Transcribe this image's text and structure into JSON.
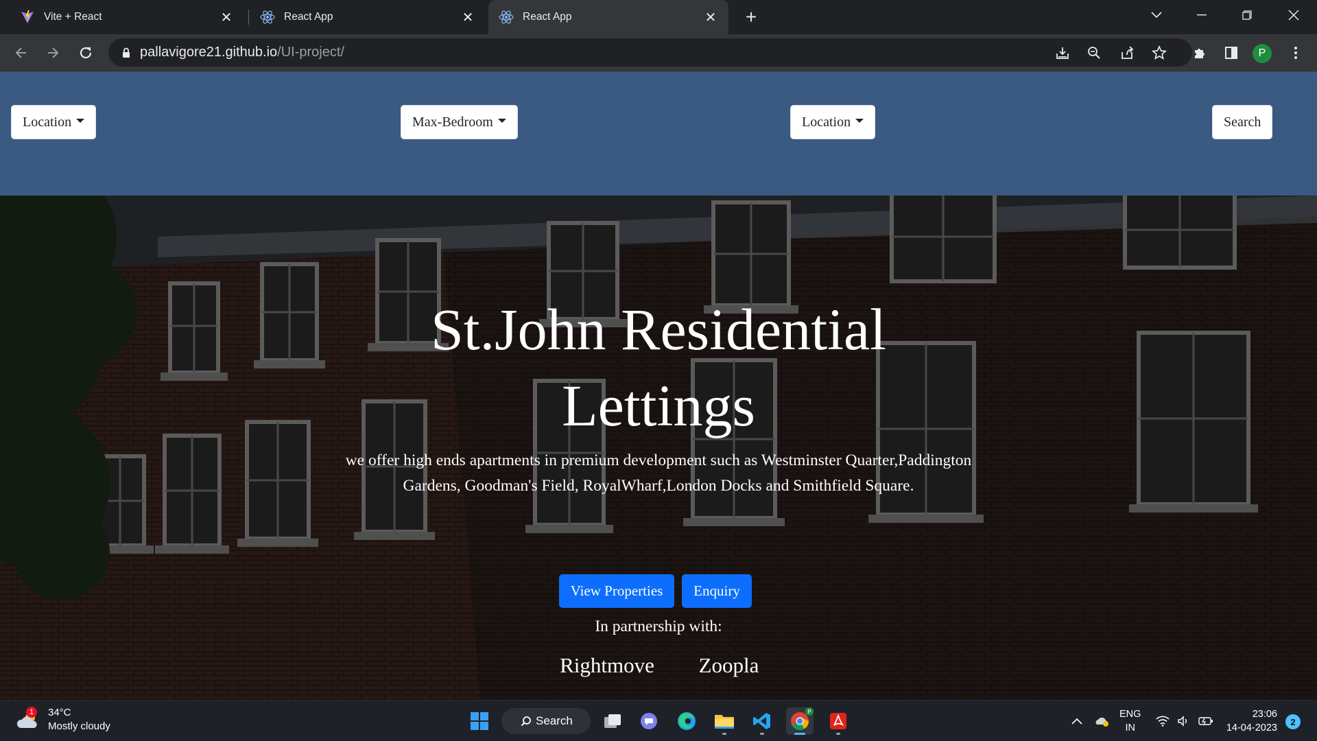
{
  "browser": {
    "tabs": [
      {
        "title": "Vite + React",
        "icon": "vite-icon",
        "active": false
      },
      {
        "title": "React App",
        "icon": "react-icon",
        "active": false
      },
      {
        "title": "React App",
        "icon": "react-icon",
        "active": true
      }
    ],
    "url_host": "pallavigore21.github.io",
    "url_path": "/UI-project/",
    "profile_initial": "P"
  },
  "navbar": {
    "location_1": "Location",
    "max_bedroom": "Max-Bedroom",
    "location_2": "Location",
    "search": "Search"
  },
  "hero": {
    "title_line1": "St.John Residential",
    "title_line2": "Lettings",
    "description": "we offer high ends apartments in premium development such as Westminster Quarter,Paddington Gardens, Goodman's Field, RoyalWharf,London Docks and Smithfield Square.",
    "view_properties": "View Properties",
    "enquiry": "Enquiry",
    "partnership_label": "In partnership with:",
    "partners": [
      "Rightmove",
      "Zoopla"
    ]
  },
  "taskbar": {
    "weather_temp": "34°C",
    "weather_desc": "Mostly cloudy",
    "weather_badge": "1",
    "search_label": "Search",
    "lang_line1": "ENG",
    "lang_line2": "IN",
    "time": "23:06",
    "date": "14-04-2023",
    "notification_count": "2"
  },
  "colors": {
    "navbar_bg": "#3a5a82",
    "primary_button": "#0d6efd",
    "chrome_dark": "#202124"
  }
}
